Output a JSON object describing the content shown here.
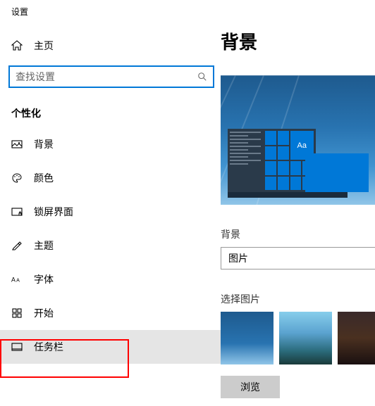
{
  "window_title": "设置",
  "home": {
    "label": "主页"
  },
  "search": {
    "placeholder": "查找设置"
  },
  "category": {
    "label": "个性化"
  },
  "nav": {
    "background": "背景",
    "colors": "颜色",
    "lockscreen": "锁屏界面",
    "themes": "主题",
    "fonts": "字体",
    "start": "开始",
    "taskbar": "任务栏"
  },
  "content": {
    "title": "背景",
    "preview_sample": "Aa",
    "bg_label": "背景",
    "bg_dropdown_value": "图片",
    "choose_label": "选择图片",
    "browse_label": "浏览"
  }
}
